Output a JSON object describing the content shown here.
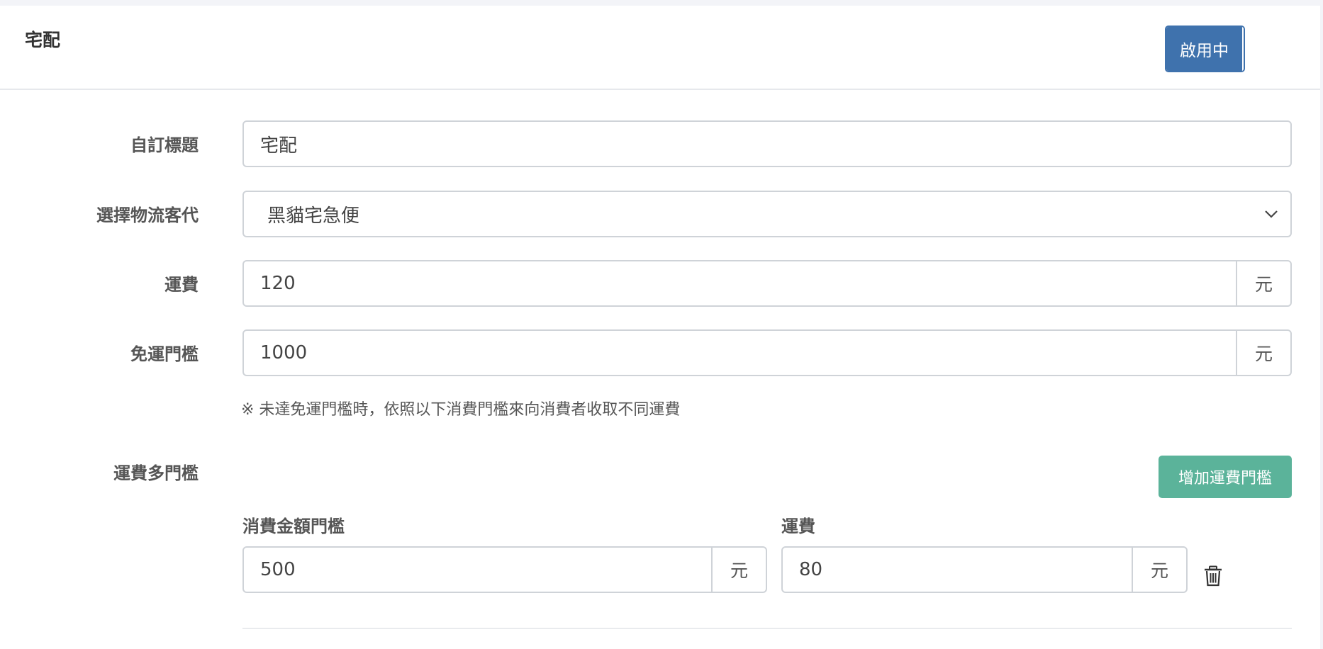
{
  "header": {
    "title": "宅配",
    "toggle_label": "啟用中"
  },
  "form": {
    "custom_title": {
      "label": "自訂標題",
      "value": "宅配"
    },
    "logistics": {
      "label": "選擇物流客代",
      "value": "黑貓宅急便"
    },
    "shipping_fee": {
      "label": "運費",
      "value": "120",
      "unit": "元"
    },
    "free_shipping_threshold": {
      "label": "免運門檻",
      "value": "1000",
      "unit": "元"
    },
    "hint": "※ 未達免運門檻時，依照以下消費門檻來向消費者收取不同運費"
  },
  "tiers": {
    "label": "運費多門檻",
    "add_button": "增加運費門檻",
    "col_amount": "消費金額門檻",
    "col_fee": "運費",
    "rows": [
      {
        "amount": "500",
        "amount_unit": "元",
        "fee": "80",
        "fee_unit": "元"
      }
    ]
  },
  "icons": {
    "select_arrow": "chevron-down-icon",
    "delete": "trash-icon"
  },
  "colors": {
    "toggle": "#3f72ad",
    "add_button": "#5bb39a"
  }
}
